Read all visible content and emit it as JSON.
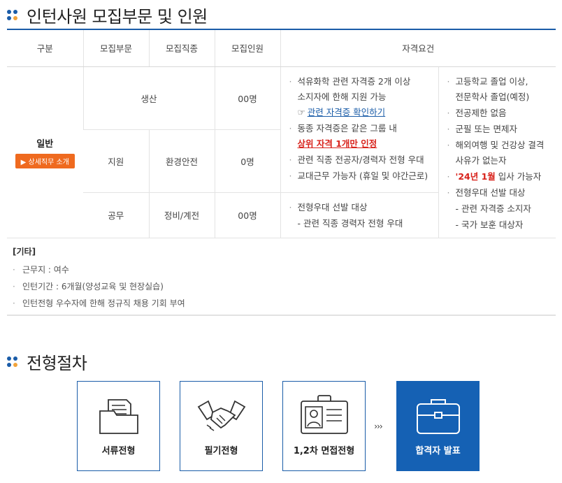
{
  "section1": {
    "title": "인턴사원 모집부문 및 인원"
  },
  "table": {
    "headers": [
      "구분",
      "모집부문",
      "모집직종",
      "모집인원",
      "자격요건"
    ],
    "general_label": "일반",
    "detail_button": "▶ 상세직무 소개",
    "row1": {
      "dept": "생산",
      "count": "00명"
    },
    "row2": {
      "dept": "지원",
      "job": "환경안전",
      "count": "0명"
    },
    "row3": {
      "dept": "공무",
      "job": "정비/계전",
      "count": "00명"
    },
    "qual_left_1": {
      "item1_a": "석유화학 관련 자격증 2개 이상",
      "item1_b": "소지자에 한해 지원 가능",
      "hand": "☞",
      "link": "관련 자격증 확인하기",
      "item2_a": "동종 자격증은 같은 그룹 내",
      "item2_b": "상위 자격 1개만 인정",
      "item3": "관련 직종 전공자/경력자 전형 우대",
      "item4": "교대근무 가능자 (휴일 및 야간근로)"
    },
    "qual_left_2": {
      "item1": "전형우대 선발 대상",
      "item2": "- 관련 직종 경력자 전형 우대"
    },
    "qual_right": {
      "item1_a": "고등학교 졸업 이상,",
      "item1_b": "전문학사 졸업(예정)",
      "item2": "전공제한 없음",
      "item3": "군필 또는 면제자",
      "item4_a": "해외여행 및 건강상 결격",
      "item4_b": "사유가 없는자",
      "item5_red": "'24년 1월",
      "item5_rest": " 입사 가능자",
      "item6": "전형우대 선발 대상",
      "item7": "- 관련 자격증 소지자",
      "item8": "- 국가 보훈 대상자"
    }
  },
  "etc": {
    "title": "[기타]",
    "items": [
      "근무지 : 여수",
      "인턴기간 : 6개월(양성교육 및 현장실습)",
      "인턴전형 우수자에 한해 정규직 채용 기회 부여"
    ]
  },
  "section2": {
    "title": "전형절차"
  },
  "steps": [
    {
      "label": "서류전형",
      "icon": "folder-icon"
    },
    {
      "label": "필기전형",
      "icon": "handshake-icon"
    },
    {
      "label": "1,2차 면접전형",
      "icon": "id-card-icon"
    },
    {
      "label": "합격자 발표",
      "icon": "briefcase-icon"
    }
  ],
  "arrows": "›››",
  "colors": {
    "accent": "#1a5ca8",
    "orange": "#ef6a1f",
    "red": "#d8221b",
    "final_bg": "#1561b4"
  }
}
